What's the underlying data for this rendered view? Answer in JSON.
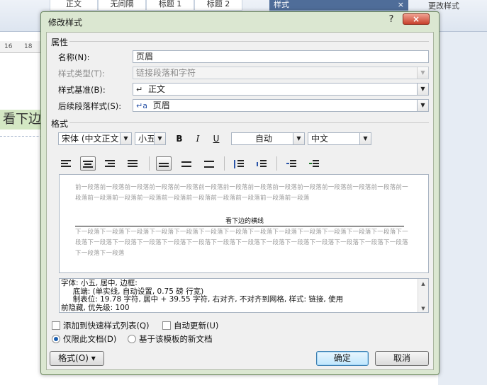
{
  "background": {
    "style_gallery": [
      "正文",
      "无间隔",
      "标题 1",
      "标题 2"
    ],
    "styles_pane_title": "样式",
    "styles_pane_close": "×",
    "change_styles_label": "更改样式",
    "ruler_marks": [
      "16",
      "18"
    ],
    "doc_heading_text": "看下边"
  },
  "dialog": {
    "title": "修改样式",
    "help_label": "?",
    "close_label": "×",
    "properties": {
      "section_title": "属性",
      "name_label": "名称(N):",
      "name_value": "页眉",
      "style_type_label": "样式类型(T):",
      "style_type_value": "链接段落和字符",
      "style_based_on_label": "样式基准(B):",
      "style_based_on_symbol": "↵",
      "style_based_on_value": "正文",
      "next_para_label": "后续段落样式(S):",
      "next_para_symbol": "↵a",
      "next_para_value": "页眉"
    },
    "formatting": {
      "section_title": "格式",
      "font_value": "宋体 (中文正文",
      "size_value": "小五",
      "bold_label": "B",
      "italic_label": "I",
      "underline_label": "U",
      "color_value": "自动",
      "script_value": "中文",
      "selected_alignment": "center"
    },
    "preview": {
      "before_text": "前一段落前一段落前一段落前一段落前一段落前一段落前一段落前一段落前一段落前一段落前一段落前一段落前一段落前一段落前一段落前一段落前一段落前一段落前一段落前一段落前一段落前一段落前一段落",
      "sample_text": "看下边的横线",
      "after_text": "下一段落下一段落下一段落下一段落下一段落下一段落下一段落下一段落下一段落下一段落下一段落下一段落下一段落下一段落下一段落下一段落下一段落下一段落下一段落下一段落下一段落下一段落下一段落下一段落下一段落下一段落下一段落下一段落下一段落"
    },
    "description": "字体: 小五, 居中, 边框:\n     底端: (单实线, 自动设置, 0.75 磅 行宽)\n     制表位: 19.78 字符, 居中 + 39.55 字符, 右对齐, 不对齐到网格, 样式: 链接, 使用\n前隐藏, 优先级: 100",
    "options": {
      "add_to_quick_styles_label": "添加到快速样式列表(Q)",
      "add_to_quick_styles_checked": false,
      "auto_update_label": "自动更新(U)",
      "auto_update_checked": false,
      "only_this_doc_label": "仅限此文档(D)",
      "new_docs_template_label": "基于该模板的新文档",
      "selected_scope": "only_this_doc"
    },
    "buttons": {
      "format_label": "格式(O) ▾",
      "ok_label": "确定",
      "cancel_label": "取消"
    }
  }
}
